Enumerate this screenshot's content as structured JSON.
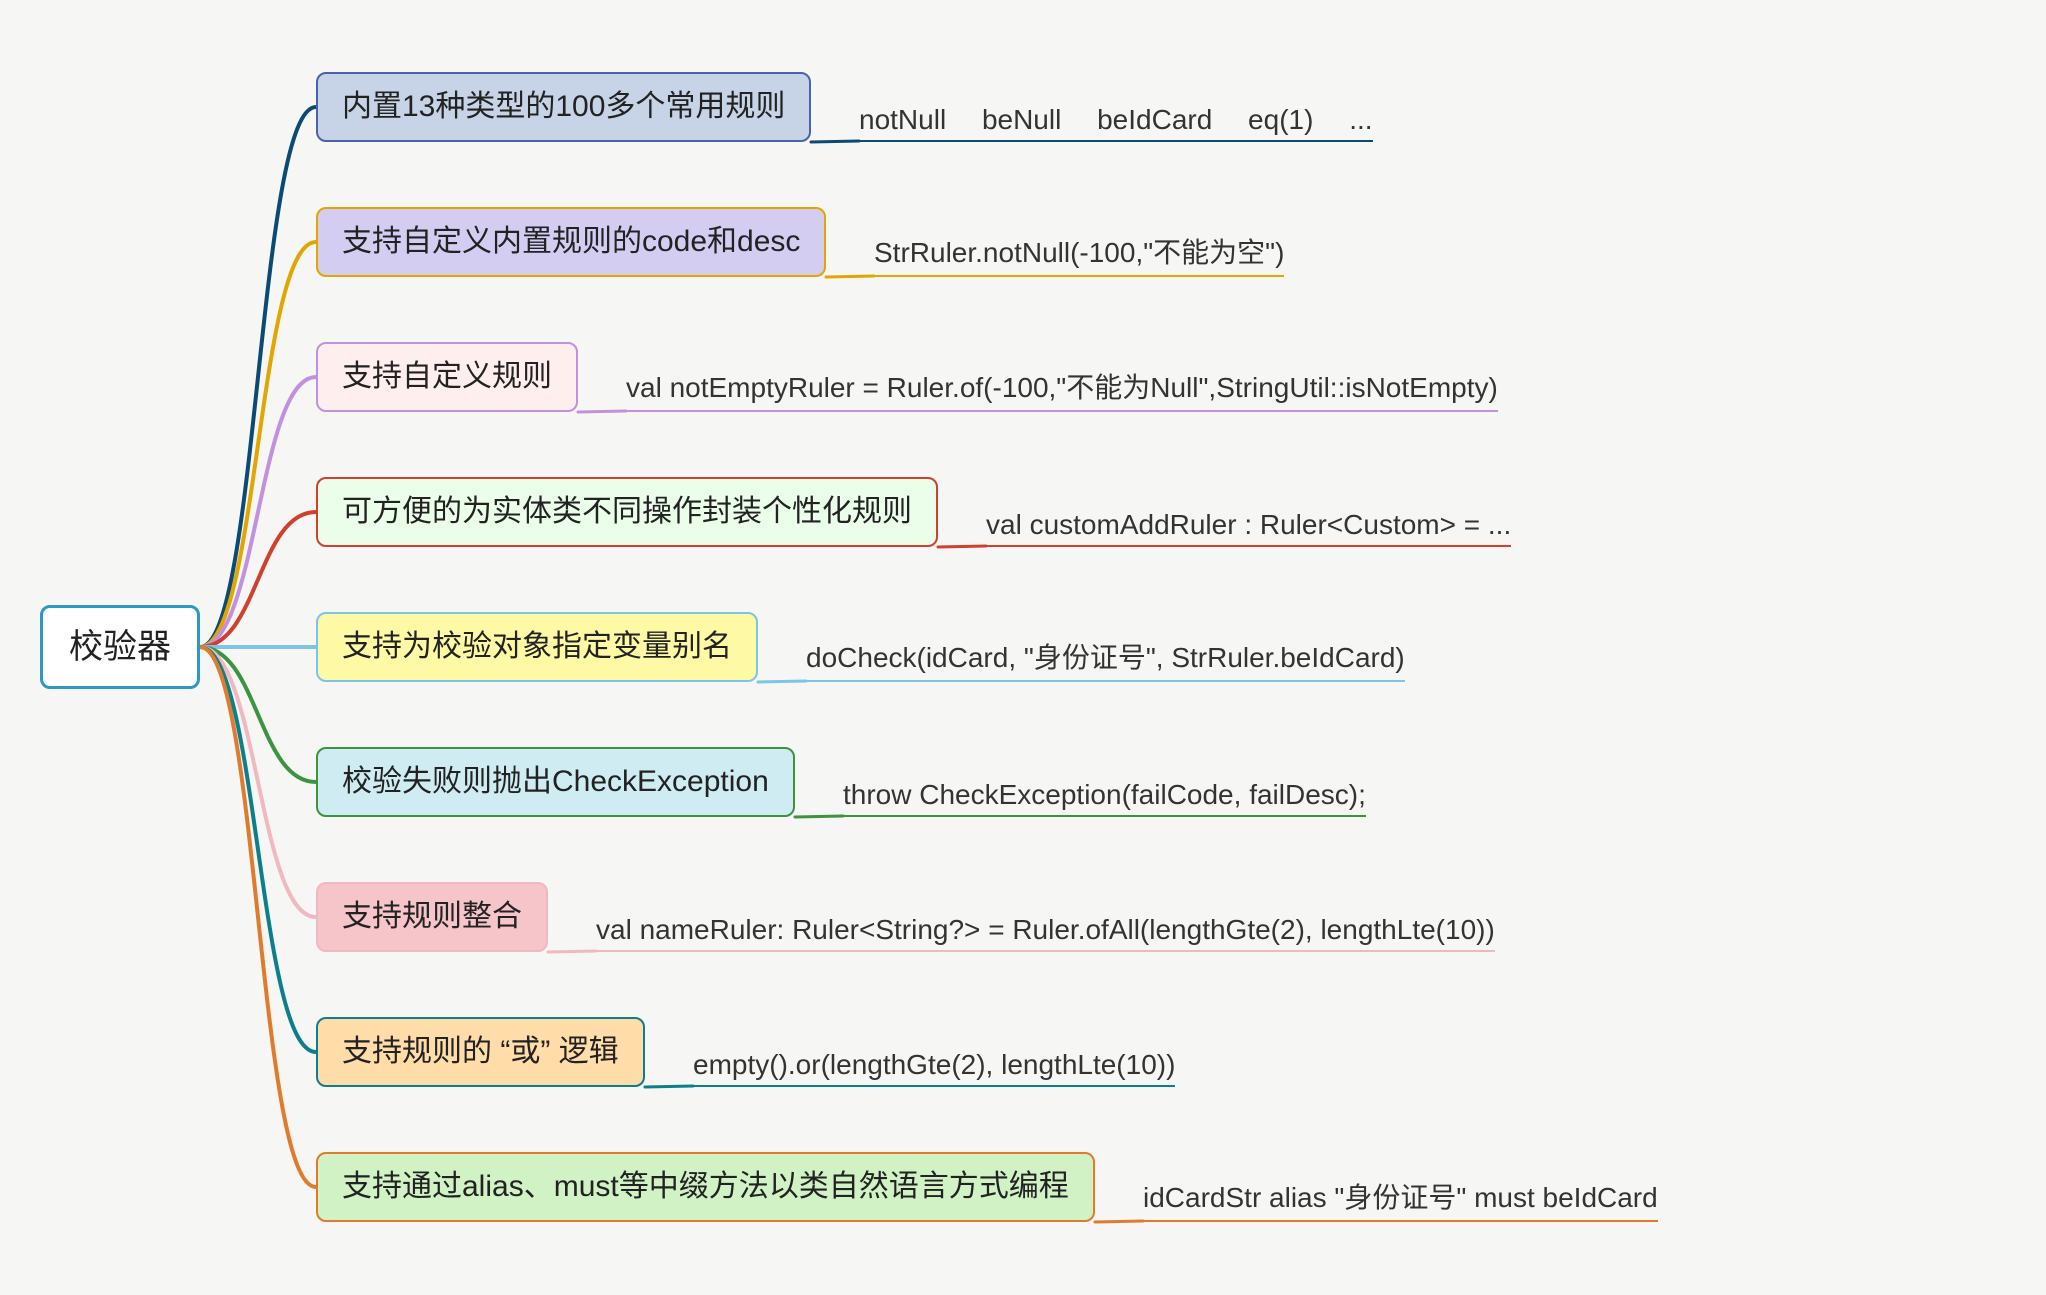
{
  "root": {
    "label": "校验器"
  },
  "branches": [
    {
      "id": "b0",
      "color": "#0a4a74",
      "fill": "#c7d4e8",
      "border": "#4a63a8",
      "label": "内置13种类型的100多个常用规则",
      "leaf": "notNull   beNull   beIdCard   eq(1)   ..."
    },
    {
      "id": "b1",
      "color": "#e3a500",
      "fill": "#d3cdf1",
      "border": "#e3a500",
      "label": "支持自定义内置规则的code和desc",
      "leaf": "StrRuler.notNull(-100,\"不能为空\")"
    },
    {
      "id": "b2",
      "color": "#c390e0",
      "fill": "#ffeeee",
      "border": "#c390e0",
      "label": "支持自定义规则",
      "leaf": "val notEmptyRuler = Ruler.of(-100,\"不能为Null\",StringUtil::isNotEmpty)"
    },
    {
      "id": "b3",
      "color": "#d13f2f",
      "fill": "#eafee9",
      "border": "#d13f2f",
      "label": "可方便的为实体类不同操作封装个性化规则",
      "leaf": "val customAddRuler : Ruler<Custom>  = ..."
    },
    {
      "id": "b4",
      "color": "#7cc4e8",
      "fill": "#fdf9a4",
      "border": "#7cc4e8",
      "label": "支持为校验对象指定变量别名",
      "leaf": "doCheck(idCard, \"身份证号\", StrRuler.beIdCard)"
    },
    {
      "id": "b5",
      "color": "#3c9440",
      "fill": "#cfecf2",
      "border": "#3c9440",
      "label": "校验失败则抛出CheckException",
      "leaf": "throw CheckException(failCode, failDesc);"
    },
    {
      "id": "b6",
      "color": "#f0b8bf",
      "fill": "#f5c5c9",
      "border": "#f0b8bf",
      "label": "支持规则整合",
      "leaf": "val nameRuler: Ruler<String?> = Ruler.ofAll(lengthGte(2), lengthLte(10))"
    },
    {
      "id": "b7",
      "color": "#0d7e8c",
      "fill": "#ffdca8",
      "border": "#0d7e8c",
      "label": "支持规则的 “或” 逻辑",
      "leaf": "empty().or(lengthGte(2), lengthLte(10))"
    },
    {
      "id": "b8",
      "color": "#e07b2d",
      "fill": "#d1f2c4",
      "border": "#e07b2d",
      "label": "支持通过alias、must等中缀方法以类自然语言方式编程",
      "leaf": "idCardStr alias \"身份证号\" must beIdCard"
    }
  ]
}
